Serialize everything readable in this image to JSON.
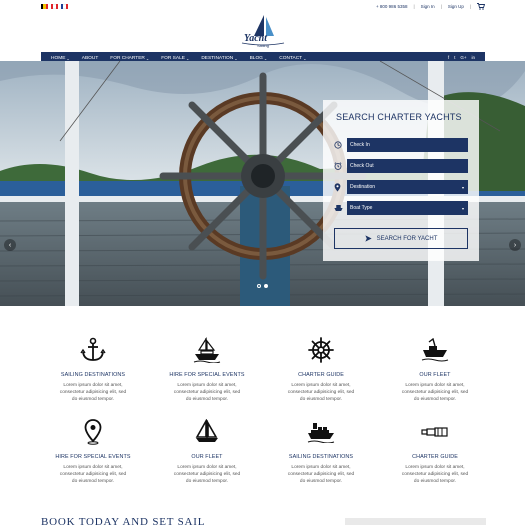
{
  "topbar": {
    "phone": "+ 800 986 5358",
    "sign_in": "Sign In",
    "sign_up": "Sign Up",
    "flags": [
      {
        "name": "belgium-flag",
        "colors": [
          "#000000",
          "#f2c500",
          "#e0252b"
        ]
      },
      {
        "name": "canada-flag",
        "colors": [
          "#e0252b",
          "#ffffff",
          "#e0252b"
        ]
      },
      {
        "name": "france-flag",
        "colors": [
          "#1d3f95",
          "#ffffff",
          "#e0252b"
        ]
      }
    ]
  },
  "logo": {
    "word": "Yacht",
    "sub": "Sailing"
  },
  "nav": {
    "items": [
      {
        "label": "HOME",
        "caret": true
      },
      {
        "label": "ABOUT",
        "caret": false
      },
      {
        "label": "FOR CHARTER",
        "caret": true
      },
      {
        "label": "FOR SALE",
        "caret": true
      },
      {
        "label": "DESTINATION",
        "caret": true
      },
      {
        "label": "BLOG",
        "caret": true
      },
      {
        "label": "CONTACT",
        "caret": true
      }
    ],
    "social": [
      "f",
      "t",
      "G+",
      "in"
    ]
  },
  "search": {
    "title": "SEARCH CHARTER YACHTS",
    "check_in": "Check In",
    "check_out": "Check Out",
    "destination": "Destination",
    "boat_type": "Boat Type",
    "button": "SEARCH FOR YACHT"
  },
  "features": [
    {
      "icon": "anchor-icon",
      "title": "SAILING DESTINATIONS",
      "lines": [
        "Lorem ipsum dolor sit amet,",
        "consectetur adipisicing elit, sed",
        "do eiusmod tempor."
      ]
    },
    {
      "icon": "ship-icon",
      "title": "HIRE FOR SPECIAL EVENTS",
      "lines": [
        "Lorem ipsum dolor sit amet,",
        "consectetur adipisicing elit, sed",
        "do eiusmod tempor."
      ]
    },
    {
      "icon": "ship-wheel-icon",
      "title": "CHARTER GUIDE",
      "lines": [
        "Lorem ipsum dolor sit amet,",
        "consectetur adipisicing elit, sed",
        "do eiusmod tempor."
      ]
    },
    {
      "icon": "speedboat-icon",
      "title": "OUR FLEET",
      "lines": [
        "Lorem ipsum dolor sit amet,",
        "consectetur adipisicing elit, sed",
        "do eiusmod tempor."
      ]
    },
    {
      "icon": "map-pin-icon",
      "title": "HIRE FOR SPECIAL EVENTS",
      "lines": [
        "Lorem ipsum dolor sit amet,",
        "consectetur adipisicing elit, sed",
        "do eiusmod tempor."
      ]
    },
    {
      "icon": "sailboat-icon",
      "title": "OUR FLEET",
      "lines": [
        "Lorem ipsum dolor sit amet,",
        "consectetur adipisicing elit, sed",
        "do eiusmod tempor."
      ]
    },
    {
      "icon": "cargo-ship-icon",
      "title": "SAILING DESTINATIONS",
      "lines": [
        "Lorem ipsum dolor sit amet,",
        "consectetur adipisicing elit, sed",
        "do eiusmod tempor."
      ]
    },
    {
      "icon": "telescope-icon",
      "title": "CHARTER GUIDE",
      "lines": [
        "Lorem ipsum dolor sit amet,",
        "consectetur adipisicing elit, sed",
        "do eiusmod tempor."
      ]
    }
  ],
  "bottom": {
    "title": "BOOK TODAY AND SET SAIL"
  },
  "colors": {
    "brand_navy": "#1d3464",
    "white": "#ffffff"
  }
}
